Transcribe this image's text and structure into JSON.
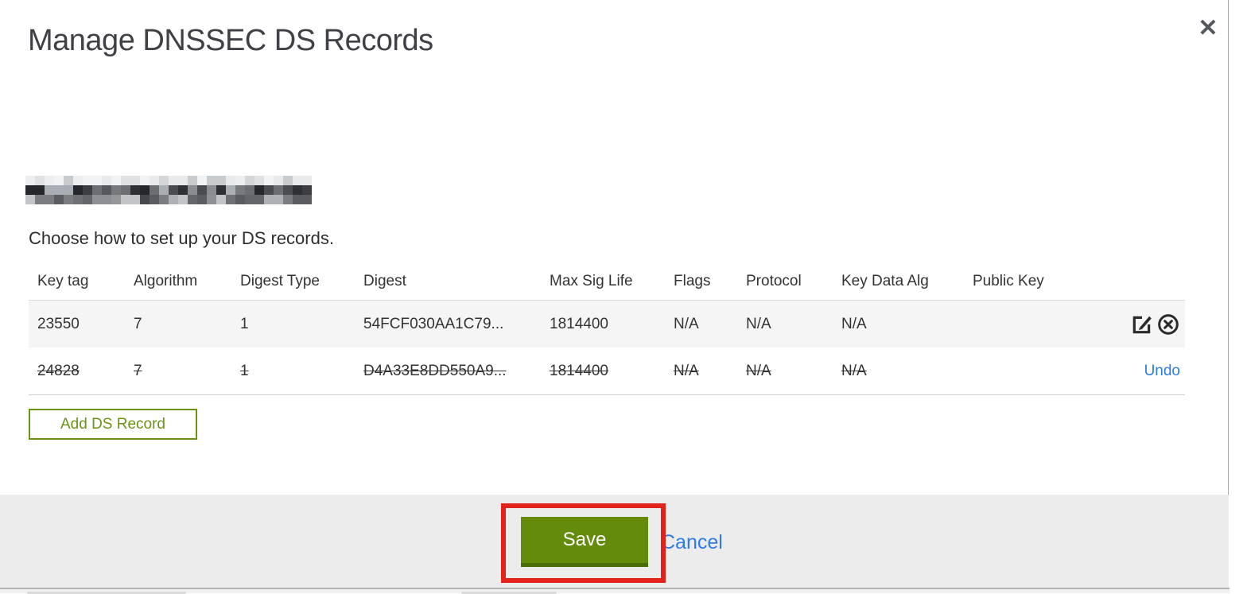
{
  "modal": {
    "title": "Manage DNSSEC DS Records",
    "close_glyph": "✕"
  },
  "domain": {
    "redacted": true,
    "note": "domain name pixelated"
  },
  "instruction": "Choose how to set up your DS records.",
  "table": {
    "columns": [
      "Key tag",
      "Algorithm",
      "Digest Type",
      "Digest",
      "Max Sig Life",
      "Flags",
      "Protocol",
      "Key Data Alg",
      "Public Key"
    ],
    "rows": [
      {
        "cells": [
          "23550",
          "7",
          "1",
          "54FCF030AA1C79...",
          "1814400",
          "N/A",
          "N/A",
          "N/A",
          ""
        ],
        "deleted": false,
        "actions": [
          "edit",
          "delete"
        ]
      },
      {
        "cells": [
          "24828",
          "7",
          "1",
          "D4A33E8DD550A9...",
          "1814400",
          "N/A",
          "N/A",
          "N/A",
          ""
        ],
        "deleted": true,
        "undo_label": "Undo"
      }
    ]
  },
  "buttons": {
    "add_ds_record": "Add DS Record",
    "save": "Save",
    "cancel": "Cancel"
  },
  "colors": {
    "accent_green": "#648c0a",
    "outline_green": "#6b9313",
    "link_blue": "#2b7de0",
    "annotation_red": "#e3231b",
    "row_alt_bg": "#f5f5f5",
    "footer_bg": "#ececec"
  }
}
